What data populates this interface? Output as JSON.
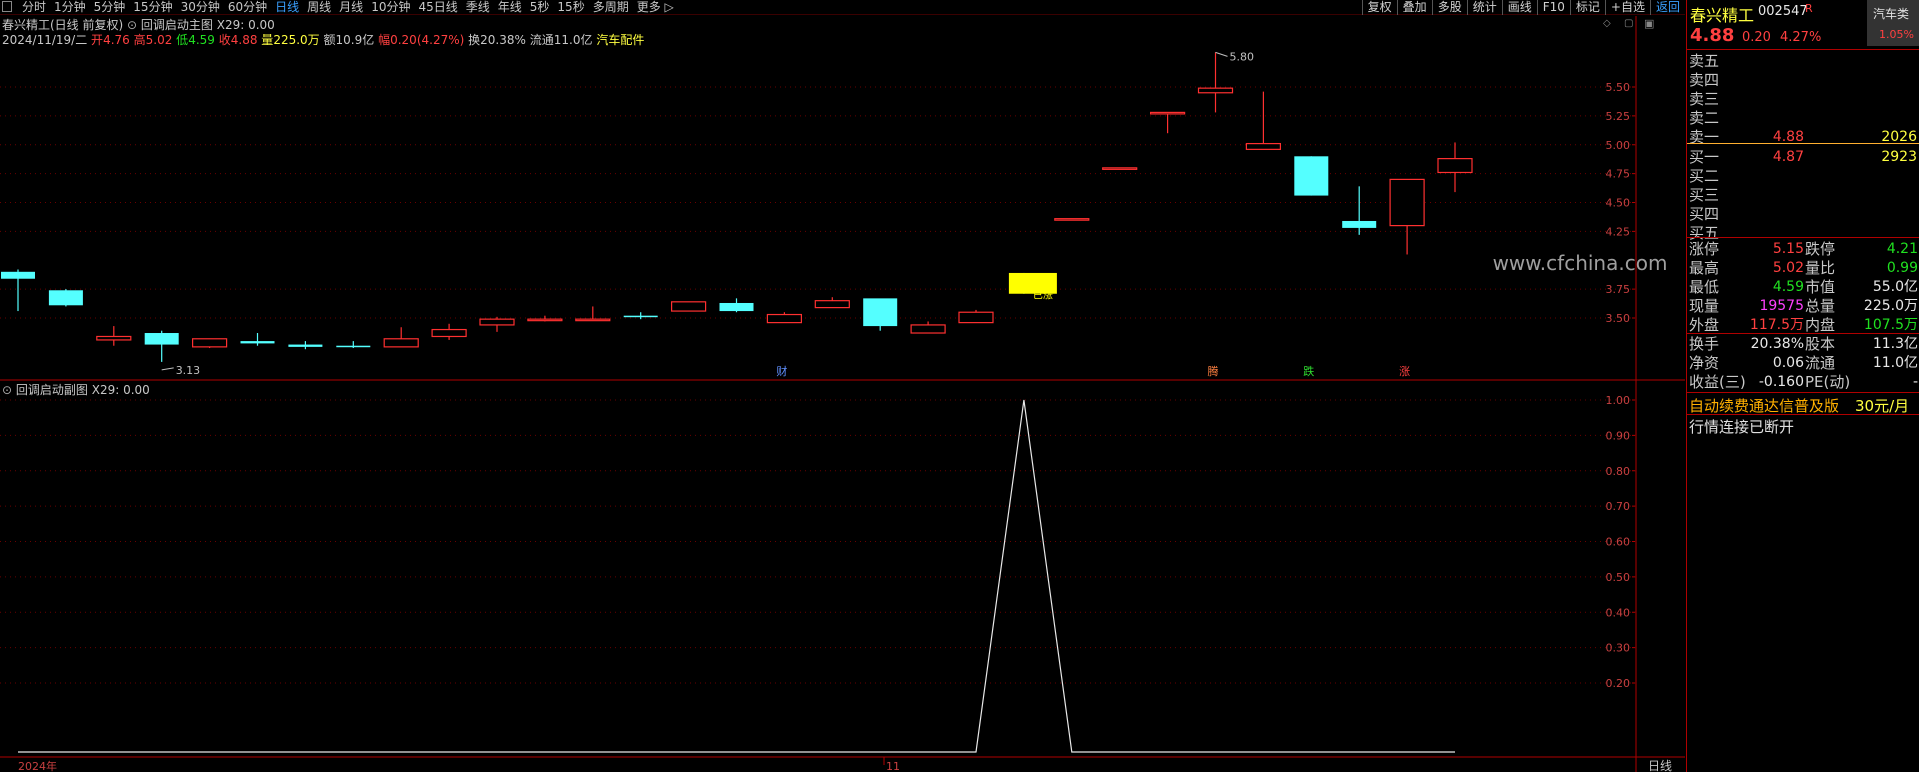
{
  "toolbar": {
    "periods": [
      "分时",
      "1分钟",
      "5分钟",
      "15分钟",
      "30分钟",
      "60分钟",
      "日线",
      "周线",
      "月线",
      "10分钟",
      "45日线",
      "季线",
      "年线",
      "5秒",
      "15秒",
      "多周期",
      "更多"
    ],
    "active_period": "日线",
    "buttons": [
      "复权",
      "叠加",
      "多股",
      "统计",
      "画线",
      "F10",
      "标记",
      "+自选",
      "返回"
    ],
    "active_button": "返回"
  },
  "main_chart": {
    "title": "春兴精工(日线 前复权)",
    "indicator": "回调启动主图",
    "indicator_value": "X29: 0.00",
    "info": {
      "date": "2024/11/19/二",
      "open_label": "开",
      "open": "4.76",
      "high_label": "高",
      "high": "5.02",
      "low_label": "低",
      "low": "4.59",
      "close_label": "收",
      "close": "4.88",
      "vol_label": "量",
      "vol": "225.0万",
      "amount_label": "额",
      "amount": "10.9亿",
      "change_label": "幅",
      "change": "0.20(4.27%)",
      "turnover_label": "换",
      "turnover": "20.38%",
      "float_label": "流通",
      "float": "11.0亿",
      "sector": "汽车配件"
    },
    "high_mark": "5.80",
    "low_mark": "3.13",
    "watermark": "www.cfchina.com",
    "yellow_tag": "已涨",
    "events": [
      {
        "text": "财",
        "color": "#6090ff",
        "idx": 16
      },
      {
        "text": "腾",
        "color": "#ff8040",
        "idx": 25
      },
      {
        "text": "跌",
        "color": "#30e030",
        "idx": 27
      },
      {
        "text": "涨",
        "color": "#ff4040",
        "idx": 29
      }
    ],
    "yaxis": [
      "5.50",
      "5.25",
      "5.00",
      "4.75",
      "4.50",
      "4.25",
      "3.75",
      "3.50"
    ]
  },
  "chart_data": [
    {
      "type": "candlestick",
      "title": "春兴精工(日线 前复权)",
      "ohlc": [
        [
          3.9,
          3.92,
          3.56,
          3.84
        ],
        [
          3.74,
          3.75,
          3.6,
          3.61
        ],
        [
          3.31,
          3.43,
          3.26,
          3.34
        ],
        [
          3.37,
          3.39,
          3.12,
          3.27
        ],
        [
          3.25,
          3.32,
          3.24,
          3.32
        ],
        [
          3.3,
          3.37,
          3.26,
          3.28
        ],
        [
          3.27,
          3.3,
          3.23,
          3.25
        ],
        [
          3.26,
          3.3,
          3.24,
          3.25
        ],
        [
          3.25,
          3.42,
          3.25,
          3.32
        ],
        [
          3.34,
          3.45,
          3.31,
          3.4
        ],
        [
          3.44,
          3.51,
          3.38,
          3.49
        ],
        [
          3.48,
          3.52,
          3.47,
          3.49
        ],
        [
          3.48,
          3.6,
          3.48,
          3.49
        ],
        [
          3.52,
          3.55,
          3.49,
          3.51
        ],
        [
          3.56,
          3.63,
          3.56,
          3.64
        ],
        [
          3.63,
          3.67,
          3.55,
          3.56
        ],
        [
          3.46,
          3.55,
          3.47,
          3.53
        ],
        [
          3.59,
          3.68,
          3.59,
          3.65
        ],
        [
          3.67,
          3.66,
          3.39,
          3.43
        ],
        [
          3.37,
          3.47,
          3.37,
          3.44
        ],
        [
          3.46,
          3.57,
          3.46,
          3.55
        ],
        [
          3.89,
          3.89,
          3.71,
          3.71
        ],
        [
          4.36,
          4.36,
          4.36,
          4.36
        ],
        [
          4.8,
          4.8,
          4.8,
          4.8
        ],
        [
          5.28,
          5.28,
          5.1,
          5.28
        ],
        [
          5.45,
          5.8,
          5.28,
          5.49
        ],
        [
          4.96,
          5.46,
          4.96,
          5.01
        ],
        [
          4.9,
          4.9,
          4.56,
          4.56
        ],
        [
          4.34,
          4.64,
          4.22,
          4.28
        ],
        [
          4.3,
          4.7,
          4.05,
          4.7
        ],
        [
          4.76,
          5.02,
          4.59,
          4.88
        ]
      ],
      "up_color": "#ff3030",
      "down_color": "#54ffff",
      "ylim": [
        3.1,
        5.85
      ]
    },
    {
      "type": "line",
      "title": "回调启动副图",
      "series": [
        {
          "name": "X29",
          "values": [
            0,
            0,
            0,
            0,
            0,
            0,
            0,
            0,
            0,
            0,
            0,
            0,
            0,
            0,
            0,
            0,
            0,
            0,
            0,
            0,
            0,
            1,
            0,
            0,
            0,
            0,
            0,
            0,
            0,
            0,
            0
          ]
        }
      ],
      "ylim": [
        0,
        1.0
      ],
      "yticks": [
        "1.00",
        "0.90",
        "0.80",
        "0.70",
        "0.60",
        "0.50",
        "0.40",
        "0.30",
        "0.20"
      ],
      "x_labels": [
        "2024年",
        "11"
      ],
      "period": "日线"
    }
  ],
  "sub_chart": {
    "title": "回调启动副图",
    "indicator_value": "X29: 0.00"
  },
  "panel": {
    "name": "春兴精工",
    "code": "002547",
    "code_flag": "R",
    "sector": "汽车类",
    "sector_pct": "1.05%",
    "price": "4.88",
    "change": "0.20",
    "pct": "4.27%",
    "asks": [
      {
        "label": "卖五",
        "price": "",
        "vol": ""
      },
      {
        "label": "卖四",
        "price": "",
        "vol": ""
      },
      {
        "label": "卖三",
        "price": "",
        "vol": ""
      },
      {
        "label": "卖二",
        "price": "",
        "vol": ""
      },
      {
        "label": "卖一",
        "price": "4.88",
        "vol": "2026"
      }
    ],
    "bids": [
      {
        "label": "买一",
        "price": "4.87",
        "vol": "2923"
      },
      {
        "label": "买二",
        "price": "",
        "vol": ""
      },
      {
        "label": "买三",
        "price": "",
        "vol": ""
      },
      {
        "label": "买四",
        "price": "",
        "vol": ""
      },
      {
        "label": "买五",
        "price": "",
        "vol": ""
      }
    ],
    "stats": [
      {
        "l1": "涨停",
        "v1": "5.15",
        "c1": "red",
        "l2": "跌停",
        "v2": "4.21",
        "c2": "green"
      },
      {
        "l1": "最高",
        "v1": "5.02",
        "c1": "red",
        "l2": "量比",
        "v2": "0.99",
        "c2": "green"
      },
      {
        "l1": "最低",
        "v1": "4.59",
        "c1": "green",
        "l2": "市值",
        "v2": "55.0亿",
        "c2": "white"
      },
      {
        "l1": "现量",
        "v1": "19575",
        "c1": "magenta",
        "l2": "总量",
        "v2": "225.0万",
        "c2": "white"
      },
      {
        "l1": "外盘",
        "v1": "117.5万",
        "c1": "red",
        "l2": "内盘",
        "v2": "107.5万",
        "c2": "green"
      }
    ],
    "fund": [
      {
        "l1": "换手",
        "v1": "20.38%",
        "l2": "股本",
        "v2": "11.3亿"
      },
      {
        "l1": "净资",
        "v1": "0.06",
        "l2": "流通",
        "v2": "11.0亿"
      },
      {
        "l1": "收益(三)",
        "v1": "-0.160",
        "l2": "PE(动)",
        "v2": "-"
      }
    ],
    "promo": "自动续费通达信普及版",
    "promo_price": "30元/月",
    "status": "行情连接已断开"
  }
}
